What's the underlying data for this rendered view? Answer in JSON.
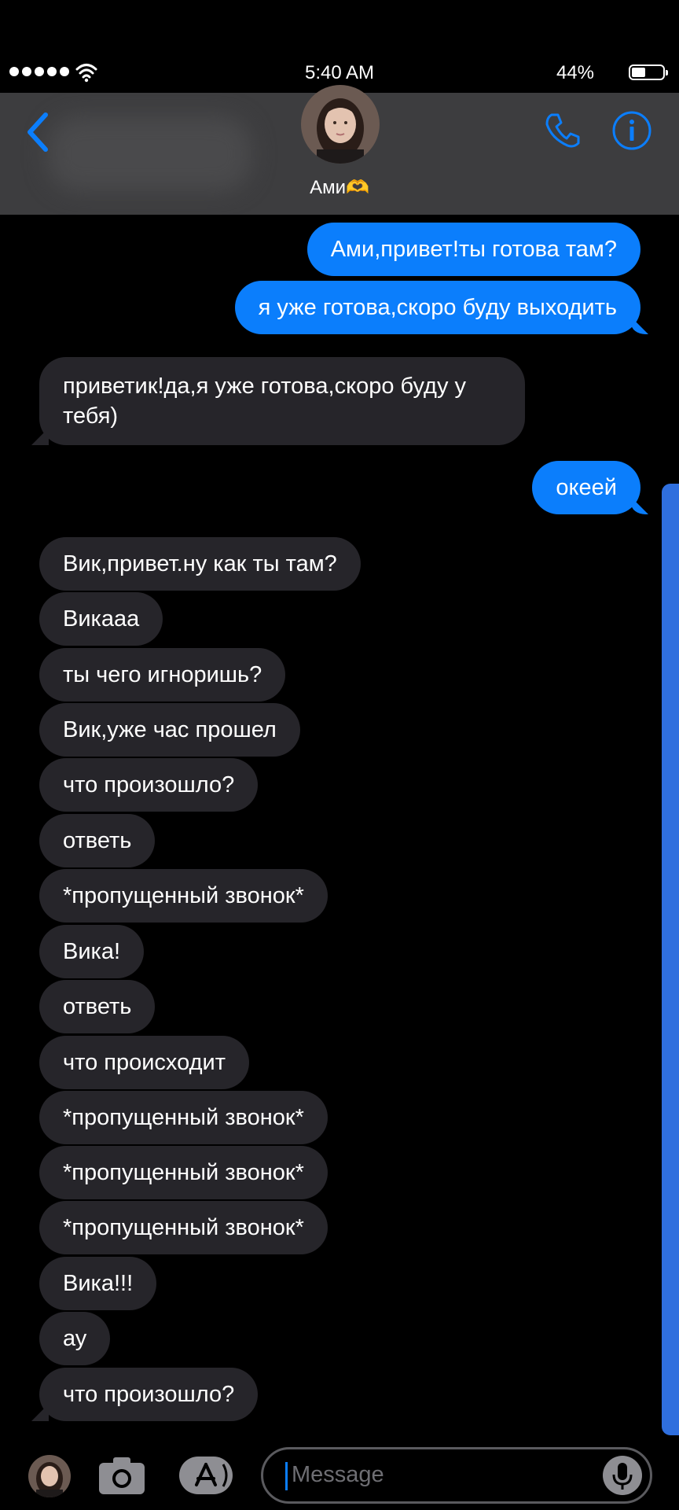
{
  "status_bar": {
    "time": "5:40 AM",
    "battery_percent": "44%",
    "battery_level": 0.44,
    "icons": [
      "signal-dots-icon",
      "wifi-icon",
      "battery-icon"
    ]
  },
  "header": {
    "contact_name": "Ами🫶",
    "icons": [
      "back-chevron-icon",
      "phone-icon",
      "info-icon"
    ],
    "accent_color": "#0b7efc"
  },
  "messages": [
    {
      "from": "me",
      "text": "Ами,привет!ты готова там?"
    },
    {
      "from": "me",
      "text": "я уже готова,скоро буду выходить"
    },
    {
      "from": "them",
      "text": "приветик!да,я уже готова,скоро буду у тебя)"
    },
    {
      "from": "me",
      "text": "океей"
    },
    {
      "from": "them",
      "text": "Вик,привет.ну как ты там?"
    },
    {
      "from": "them",
      "text": "Викааа"
    },
    {
      "from": "them",
      "text": "ты чего игноришь?"
    },
    {
      "from": "them",
      "text": "Вик,уже час прошел"
    },
    {
      "from": "them",
      "text": "что произошло?"
    },
    {
      "from": "them",
      "text": "ответь"
    },
    {
      "from": "them",
      "text": "*пропущенный звонок*"
    },
    {
      "from": "them",
      "text": "Вика!"
    },
    {
      "from": "them",
      "text": "ответь"
    },
    {
      "from": "them",
      "text": "что происходит"
    },
    {
      "from": "them",
      "text": "*пропущенный звонок*"
    },
    {
      "from": "them",
      "text": "*пропущенный звонок*"
    },
    {
      "from": "them",
      "text": "*пропущенный звонок*"
    },
    {
      "from": "them",
      "text": "Вика!!!"
    },
    {
      "from": "them",
      "text": "ау"
    },
    {
      "from": "them",
      "text": "что произошло?"
    }
  ],
  "composer": {
    "placeholder": "Message",
    "icons": [
      "camera-icon",
      "app-store-icon",
      "microphone-icon"
    ]
  },
  "colors": {
    "outgoing_bubble": "#0b7efc",
    "incoming_bubble": "#26252a",
    "header_bg": "#3d3d3f",
    "scroll_indicator": "#2f6fde"
  }
}
